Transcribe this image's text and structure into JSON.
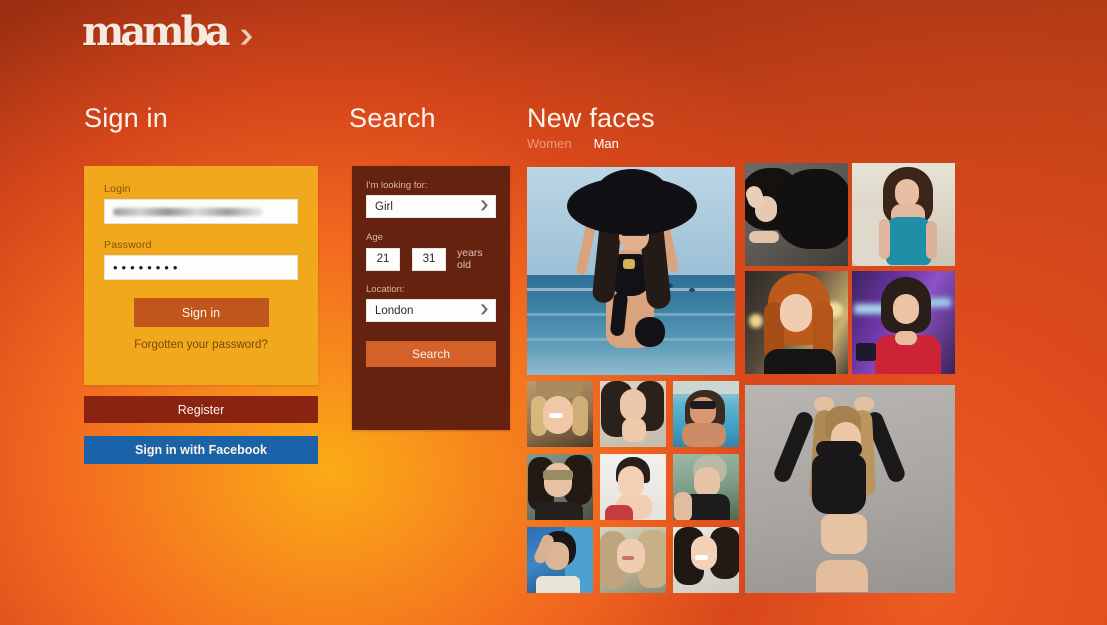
{
  "brand": {
    "logo_text": "mamba",
    "chevron_icon": "chevron-down-icon"
  },
  "signin": {
    "heading": "Sign in",
    "login_label": "Login",
    "login_value": "",
    "login_placeholder": "",
    "password_label": "Password",
    "password_value": "••••••••",
    "submit_label": "Sign in",
    "forgot_label": "Forgotten your password?",
    "register_label": "Register",
    "facebook_label": "Sign in with Facebook"
  },
  "search": {
    "heading": "Search",
    "looking_for_label": "I'm looking for:",
    "looking_for_value": "Girl",
    "age_label": "Age",
    "age_from": "21",
    "age_to": "31",
    "age_unit": "years old",
    "location_label": "Location:",
    "location_value": "London",
    "submit_label": "Search"
  },
  "new_faces": {
    "heading": "New faces",
    "tabs": [
      {
        "label": "Women",
        "active": false
      },
      {
        "label": "Man",
        "active": true
      }
    ]
  },
  "colors": {
    "signin_panel": "#f1a81c",
    "search_panel": "#65230f",
    "signin_button": "#c1561c",
    "search_button": "#d4612a",
    "register_button": "#8a2410",
    "facebook_button": "#1b63a8",
    "background_left": "#9d2f12",
    "background_glow": "#fbab16"
  }
}
